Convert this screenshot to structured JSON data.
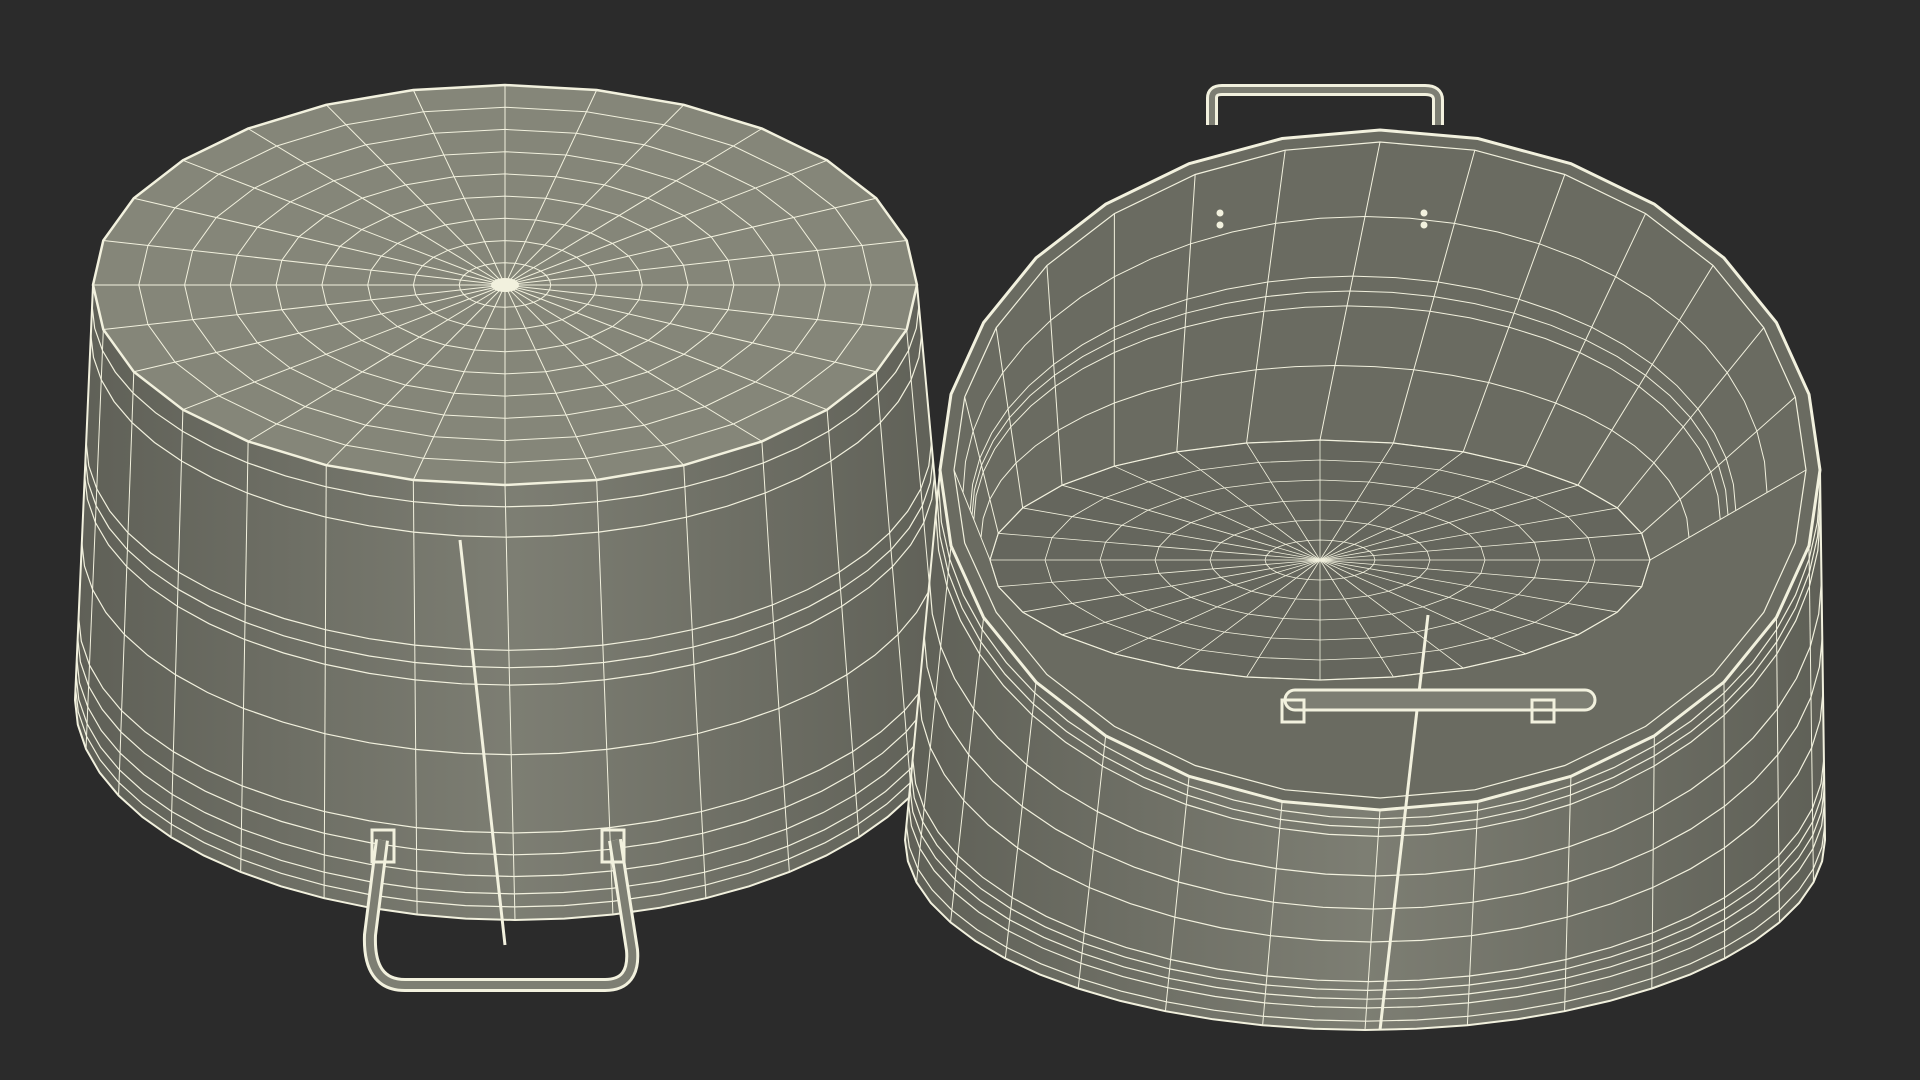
{
  "scene": {
    "background": "#2b2b2b",
    "mesh_fill": "#7d7e73",
    "mesh_fill_dark": "#5f6057",
    "interior_fill": "#6a6b61",
    "wire_color": "#f2f1de",
    "objects": [
      {
        "name": "basin-bottom-view",
        "view": "bottom",
        "radial_segments": 28,
        "rings": 9,
        "bands": 3
      },
      {
        "name": "basin-top-view",
        "view": "top-open",
        "radial_segments": 28,
        "rings": 6,
        "bands": 3
      }
    ]
  }
}
